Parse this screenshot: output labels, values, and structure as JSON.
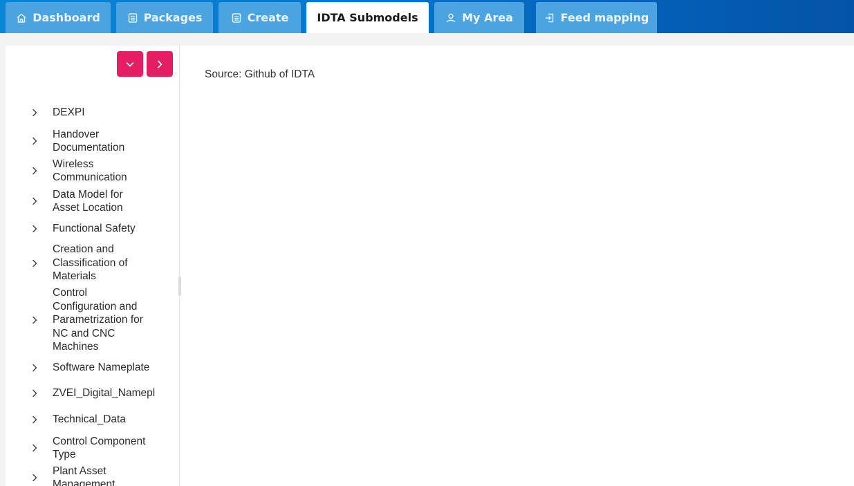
{
  "nav": {
    "tabs": [
      {
        "label": "Dashboard",
        "icon": "home-icon",
        "active": false
      },
      {
        "label": "Packages",
        "icon": "document-icon",
        "active": false
      },
      {
        "label": "Create",
        "icon": "document-icon",
        "active": false
      },
      {
        "label": "IDTA Submodels",
        "icon": "",
        "active": true
      },
      {
        "label": "My Area",
        "icon": "user-icon",
        "active": false
      },
      {
        "label": "Feed mapping",
        "icon": "feed-icon",
        "active": false
      }
    ]
  },
  "sidebar": {
    "controls": {
      "expand_icon": "chevron-down-icon",
      "collapse_icon": "chevron-right-icon"
    },
    "items": [
      {
        "label": "DEXPI"
      },
      {
        "label": "Handover\nDocumentation"
      },
      {
        "label": "Wireless\nCommunication"
      },
      {
        "label": "Data Model for\nAsset Location"
      },
      {
        "label": "Functional Safety"
      },
      {
        "label": "Creation and\nClassification of\nMaterials"
      },
      {
        "label": "Control\nConfiguration and\nParametrization for\nNC and CNC\nMachines"
      },
      {
        "label": "Software Nameplate"
      },
      {
        "label": "ZVEI_Digital_Namepl"
      },
      {
        "label": "Technical_Data"
      },
      {
        "label": "Control Component\nType"
      },
      {
        "label": "Plant Asset\nManagement"
      }
    ]
  },
  "main": {
    "source_text": "Source: Github of IDTA"
  },
  "colors": {
    "accent_pink": "#e41e64",
    "nav_blue": "#0878cc",
    "tab_blue": "#4ba3e0"
  }
}
